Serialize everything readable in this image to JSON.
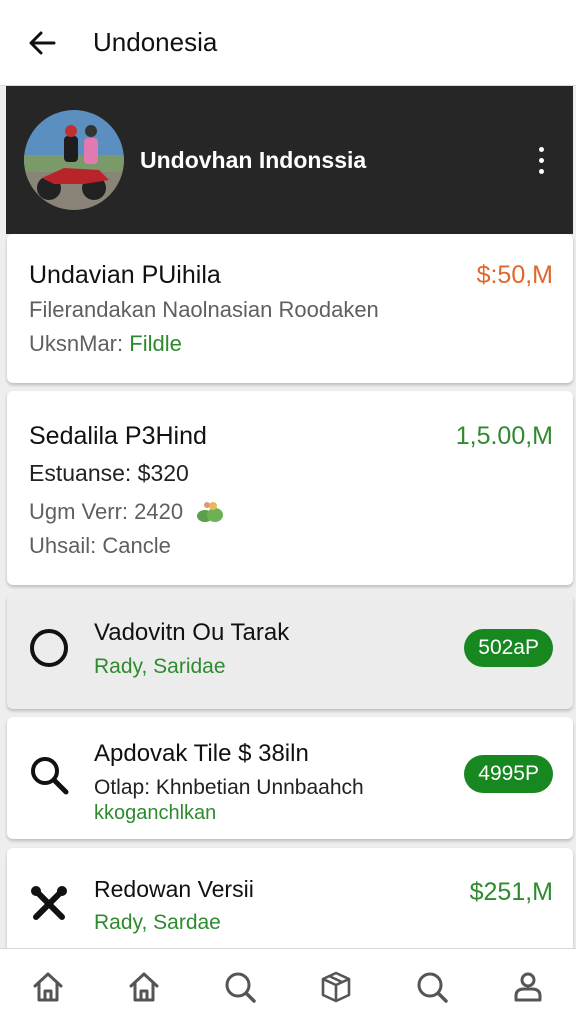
{
  "header": {
    "title": "Undonesia"
  },
  "profile": {
    "name": "Undovhan Indonssia"
  },
  "cards": [
    {
      "title": "Undavian PUihila",
      "price": "$:50,M",
      "line1": "Filerandakan Naolnasian Roodaken",
      "line2_label": "UksnMar:",
      "line2_value": "Fildle"
    },
    {
      "title": "Sedalila P3Hind",
      "price": "1,5.00,M",
      "line1": "Estuanse: $320",
      "line2": "Ugm Verr: 2420",
      "line3": "Uhsail: Cancle"
    },
    {
      "title": "Vadovitn Ou Tarak",
      "status": "Rady, Saridae",
      "badge": "502aP"
    },
    {
      "title": "Apdovak Tile $ 38iln",
      "line1": "Otlap: Khnbetian Unnbaahch",
      "line2": "kkoganchlkan",
      "badge": "4995P"
    },
    {
      "title": "Redowan Versii",
      "status": "Rady, Sardae",
      "price": "$251,M"
    }
  ],
  "colors": {
    "accent_green": "#17871f",
    "price_orange": "#e0672a",
    "profile_bg": "#262626"
  },
  "icons": {
    "header": "back-arrow-icon",
    "profile_menu": "more-vertical-icon",
    "cards": [
      "circle-icon",
      "search-icon",
      "tools-icon"
    ],
    "bottom_nav": [
      "home-icon",
      "home-icon",
      "search-icon",
      "box-icon",
      "search-icon",
      "profile-icon"
    ]
  }
}
